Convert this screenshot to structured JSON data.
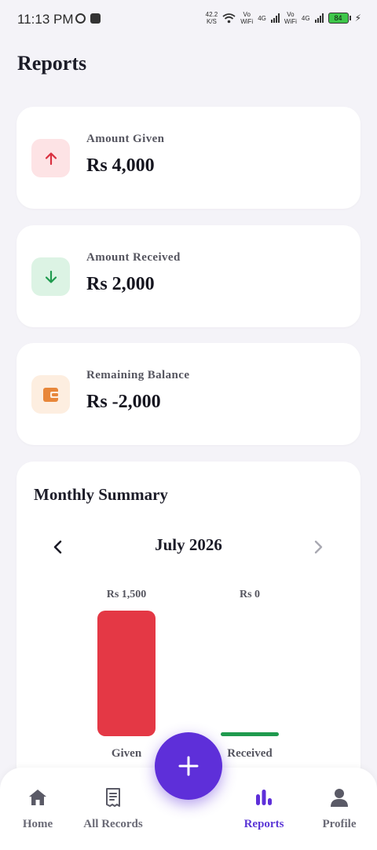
{
  "status_bar": {
    "time": "11:13 PM",
    "speed_value": "42.2",
    "speed_unit": "K/S",
    "vo_label": "Vo",
    "wifi_label": "WiFi",
    "net_label": "4G",
    "battery": "84"
  },
  "page": {
    "title": "Reports"
  },
  "stats": [
    {
      "label": "Amount Given",
      "value": "Rs 4,000",
      "icon": "arrow-up-icon",
      "icon_bg": "#fde3e5",
      "icon_color": "#d9303f"
    },
    {
      "label": "Amount Received",
      "value": "Rs 2,000",
      "icon": "arrow-down-icon",
      "icon_bg": "#dcf3e4",
      "icon_color": "#1f9a4e"
    },
    {
      "label": "Remaining Balance",
      "value": "Rs -2,000",
      "icon": "wallet-icon",
      "icon_bg": "#fdeee0",
      "icon_color": "#e8873a"
    }
  ],
  "summary": {
    "title": "Monthly Summary",
    "month": "July 2026"
  },
  "chart_data": {
    "type": "bar",
    "categories": [
      "Given",
      "Received"
    ],
    "values": [
      1500,
      0
    ],
    "value_labels": [
      "Rs 1,500",
      "Rs 0"
    ],
    "colors": [
      "#e43845",
      "#1f9a4e"
    ]
  },
  "nav": {
    "items": [
      {
        "label": "Home",
        "icon": "home-icon"
      },
      {
        "label": "All Records",
        "icon": "records-icon"
      },
      {
        "label": "Reports",
        "icon": "bar-chart-icon"
      },
      {
        "label": "Profile",
        "icon": "profile-icon"
      }
    ],
    "active": "Reports",
    "fab_icon": "plus-icon"
  },
  "colors": {
    "accent": "#5e2fd9",
    "background": "#f4f3f8"
  }
}
